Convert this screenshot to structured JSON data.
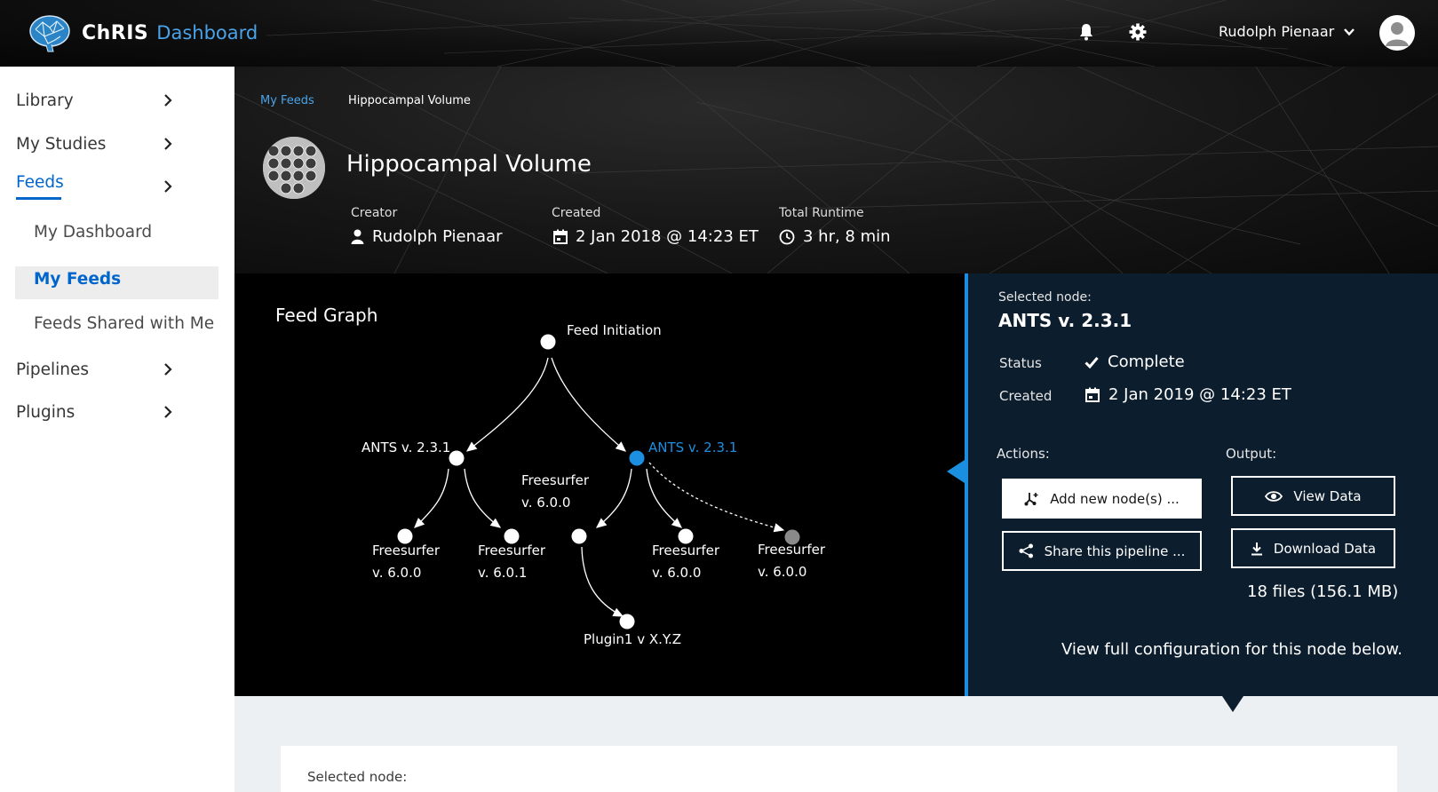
{
  "app": {
    "brand_name": "ChRIS",
    "brand_sub": "Dashboard",
    "user_name": "Rudolph Pienaar",
    "icons": [
      "brain-logo-icon",
      "bell-icon",
      "gear-icon",
      "chevron-down-icon",
      "user-avatar-icon"
    ]
  },
  "sidebar": {
    "items": [
      {
        "label": "Library"
      },
      {
        "label": "My Studies"
      },
      {
        "label": "Feeds"
      },
      {
        "label": "Pipelines"
      },
      {
        "label": "Plugins"
      }
    ],
    "feeds_sub": [
      {
        "label": "My Dashboard"
      },
      {
        "label": "My Feeds"
      },
      {
        "label": "Feeds Shared with Me"
      }
    ],
    "active_item": "Feeds",
    "active_sub": "My Feeds"
  },
  "breadcrumb": {
    "parent": "My Feeds",
    "current": "Hippocampal Volume"
  },
  "feed": {
    "title": "Hippocampal Volume",
    "creator_label": "Creator",
    "creator": "Rudolph Pienaar",
    "created_label": "Created",
    "created": "2 Jan 2018 @ 14:23 ET",
    "runtime_label": "Total Runtime",
    "runtime": "3 hr, 8 min"
  },
  "graph": {
    "title": "Feed Graph",
    "nodes": {
      "root": "Feed Initiation",
      "ants_left": "ANTS v. 2.3.1",
      "ants_right": "ANTS v. 2.3.1",
      "fs_mid": [
        "Freesurfer",
        "v. 6.0.0"
      ],
      "fs_ll": [
        "Freesurfer",
        "v. 6.0.0"
      ],
      "fs_lr": [
        "Freesurfer",
        "v. 6.0.1"
      ],
      "fs_rr": [
        "Freesurfer",
        "v. 6.0.0"
      ],
      "fs_pending": [
        "Freesurfer",
        "v. 6.0.0"
      ],
      "plugin": "Plugin1 v X.Y.Z"
    },
    "colors": {
      "selected": "#1d8fe0",
      "pending": "#8a8a8a",
      "node": "#ffffff"
    }
  },
  "detail": {
    "selected_label": "Selected node:",
    "node_name": "ANTS v. 2.3.1",
    "status_label": "Status",
    "status": "Complete",
    "created_label": "Created",
    "created": "2 Jan 2019 @ 14:23 ET",
    "actions_label": "Actions:",
    "output_label": "Output:",
    "add_node": "Add new node(s) ...",
    "share": "Share this pipeline ...",
    "view_data": "View Data",
    "download": "Download Data",
    "files": "18 files (156.1 MB)",
    "config_note": "View full configuration for this node below."
  },
  "lower": {
    "selected_label": "Selected node:"
  }
}
